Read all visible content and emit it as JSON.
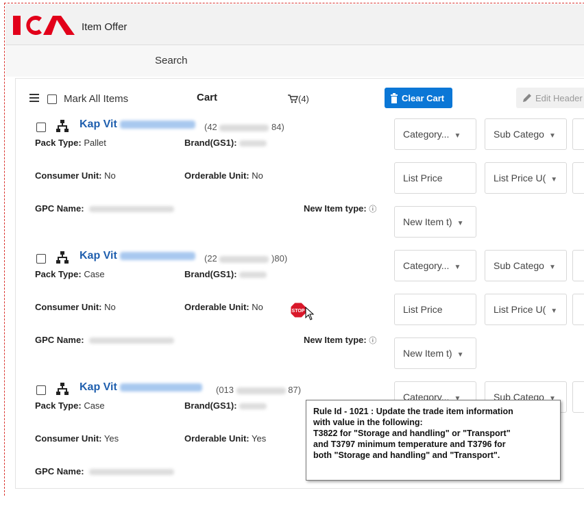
{
  "header": {
    "app_title": "Item Offer",
    "logo_text": "ICA"
  },
  "search": {
    "label": "Search"
  },
  "toolbar": {
    "mark_all_label": "Mark All Items",
    "cart_label": "Cart",
    "cart_count": "(4)",
    "clear_cart_label": "Clear Cart",
    "edit_header_label": "Edit Header"
  },
  "labels": {
    "pack_type": "Pack Type:",
    "brand": "Brand(GS1):",
    "consumer_unit": "Consumer Unit:",
    "orderable_unit": "Orderable Unit:",
    "gpc_name": "GPC Name:",
    "new_item_type": "New Item type:"
  },
  "dropdowns": {
    "category": "Category...",
    "sub_category": "Sub Catego",
    "list_price": "List Price",
    "list_price_uom": "List Price U(",
    "new_item_type": "New Item t)"
  },
  "items": [
    {
      "name": "Kap Vit",
      "code_start": "(42",
      "code_end": "84)",
      "pack_type": "Pallet",
      "consumer_unit": "No",
      "orderable_unit": "No"
    },
    {
      "name": "Kap Vit",
      "code_start": "(22",
      "code_end": ")80)",
      "pack_type": "Case",
      "consumer_unit": "No",
      "orderable_unit": "No"
    },
    {
      "name": "Kap Vit",
      "code_start": "(013",
      "code_end": "87)",
      "pack_type": "Case",
      "consumer_unit": "Yes",
      "orderable_unit": "Yes"
    }
  ],
  "tooltip": {
    "line1": "Rule Id - 1021 : Update the trade item information",
    "line2": "with value in the following:",
    "line3": "T3822 for \"Storage and handling\" or \"Transport\"",
    "line4": "and T3797 minimum temperature and T3796 for",
    "line5": "both \"Storage and handling\" and \"Transport\"."
  },
  "stop_label": "STOP",
  "colors": {
    "brand_red": "#e2001a",
    "accent_blue": "#0b77d6",
    "link_blue": "#1f5fae"
  }
}
